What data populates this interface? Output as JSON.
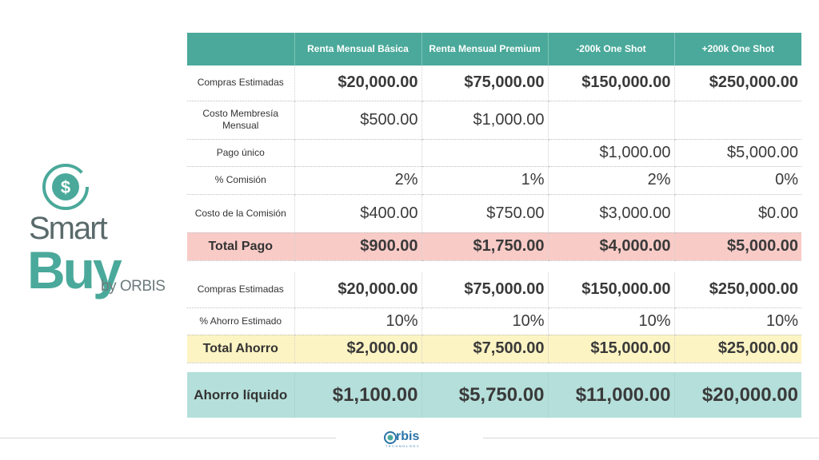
{
  "logo": {
    "smart": "Smart",
    "buy": "Buy",
    "by": "by ORBIS"
  },
  "header": {
    "cols": [
      "",
      "Renta Mensual Básica",
      "Renta Mensual Premium",
      "-200k One Shot",
      "+200k One Shot"
    ]
  },
  "table1": {
    "rows": [
      {
        "label": "Compras Estimadas",
        "values": [
          "$20,000.00",
          "$75,000.00",
          "$150,000.00",
          "$250,000.00"
        ]
      },
      {
        "label": "Costo Membresía Mensual",
        "values": [
          "$500.00",
          "$1,000.00",
          "",
          ""
        ]
      },
      {
        "label": "Pago único",
        "values": [
          "",
          "",
          "$1,000.00",
          "$5,000.00"
        ]
      },
      {
        "label": "% Comisión",
        "values": [
          "2%",
          "1%",
          "2%",
          "0%"
        ]
      },
      {
        "label": "Costo de la Comisión",
        "values": [
          "$400.00",
          "$750.00",
          "$3,000.00",
          "$0.00"
        ]
      },
      {
        "label": "Total Pago",
        "values": [
          "$900.00",
          "$1,750.00",
          "$4,000.00",
          "$5,000.00"
        ]
      }
    ]
  },
  "table2": {
    "rows": [
      {
        "label": "Compras Estimadas",
        "values": [
          "$20,000.00",
          "$75,000.00",
          "$150,000.00",
          "$250,000.00"
        ]
      },
      {
        "label": "% Ahorro Estimado",
        "values": [
          "10%",
          "10%",
          "10%",
          "10%"
        ]
      },
      {
        "label": "Total Ahorro",
        "values": [
          "$2,000.00",
          "$7,500.00",
          "$15,000.00",
          "$25,000.00"
        ]
      }
    ]
  },
  "table3": {
    "rows": [
      {
        "label": "Ahorro líquido",
        "values": [
          "$1,100.00",
          "$5,750.00",
          "$11,000.00",
          "$20,000.00"
        ]
      }
    ]
  },
  "footer": {
    "brand": "rbis",
    "sub": "TECHNOLOGY"
  },
  "colors": {
    "header_teal": "#4aa99a",
    "total_pago_pink": "#f9cbc7",
    "total_ahorro_yellow": "#fdf4c3",
    "ahorro_liquido_teal": "#b5dfda"
  }
}
